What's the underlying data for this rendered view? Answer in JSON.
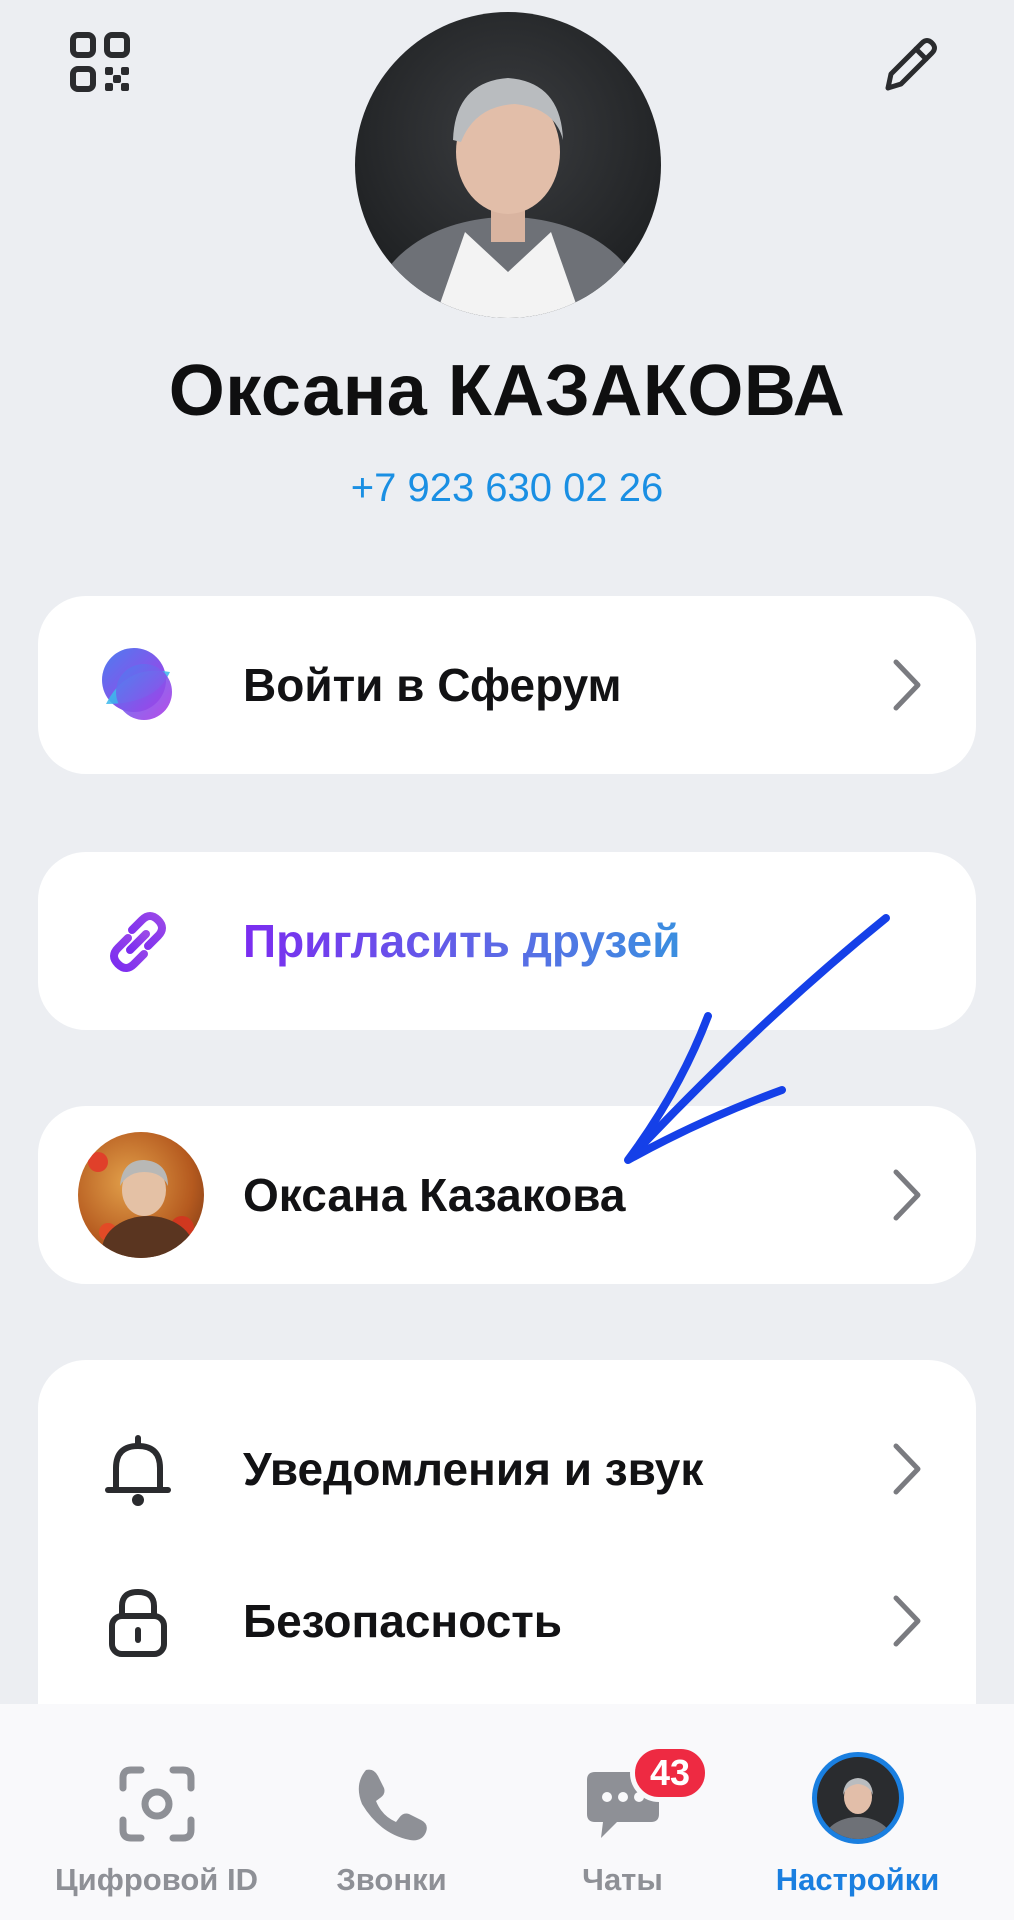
{
  "header": {
    "qr_icon": "qr-code-icon",
    "edit_icon": "pencil-icon"
  },
  "profile": {
    "name": "Оксана КАЗАКОВА",
    "phone": "+7 923 630 02 26"
  },
  "cards": {
    "sferum": {
      "label": "Войти в Сферум",
      "icon": "sferum-logo-icon"
    },
    "invite": {
      "label": "Пригласить друзей",
      "icon": "link-icon"
    },
    "account": {
      "label": "Оксана Казакова",
      "icon": "account-avatar"
    },
    "notifications": {
      "label": "Уведомления и звук",
      "icon": "bell-icon"
    },
    "security": {
      "label": "Безопасность",
      "icon": "lock-icon"
    }
  },
  "bottom_nav": {
    "items": [
      {
        "label": "Цифровой ID",
        "icon": "face-scan-icon"
      },
      {
        "label": "Звонки",
        "icon": "phone-icon"
      },
      {
        "label": "Чаты",
        "icon": "chat-icon",
        "badge": "43"
      },
      {
        "label": "Настройки",
        "icon": "avatar-icon",
        "active": true
      }
    ]
  },
  "colors": {
    "accent": "#1a7fe0",
    "badge": "#ee2a42",
    "annotation_arrow": "#1540e8"
  }
}
